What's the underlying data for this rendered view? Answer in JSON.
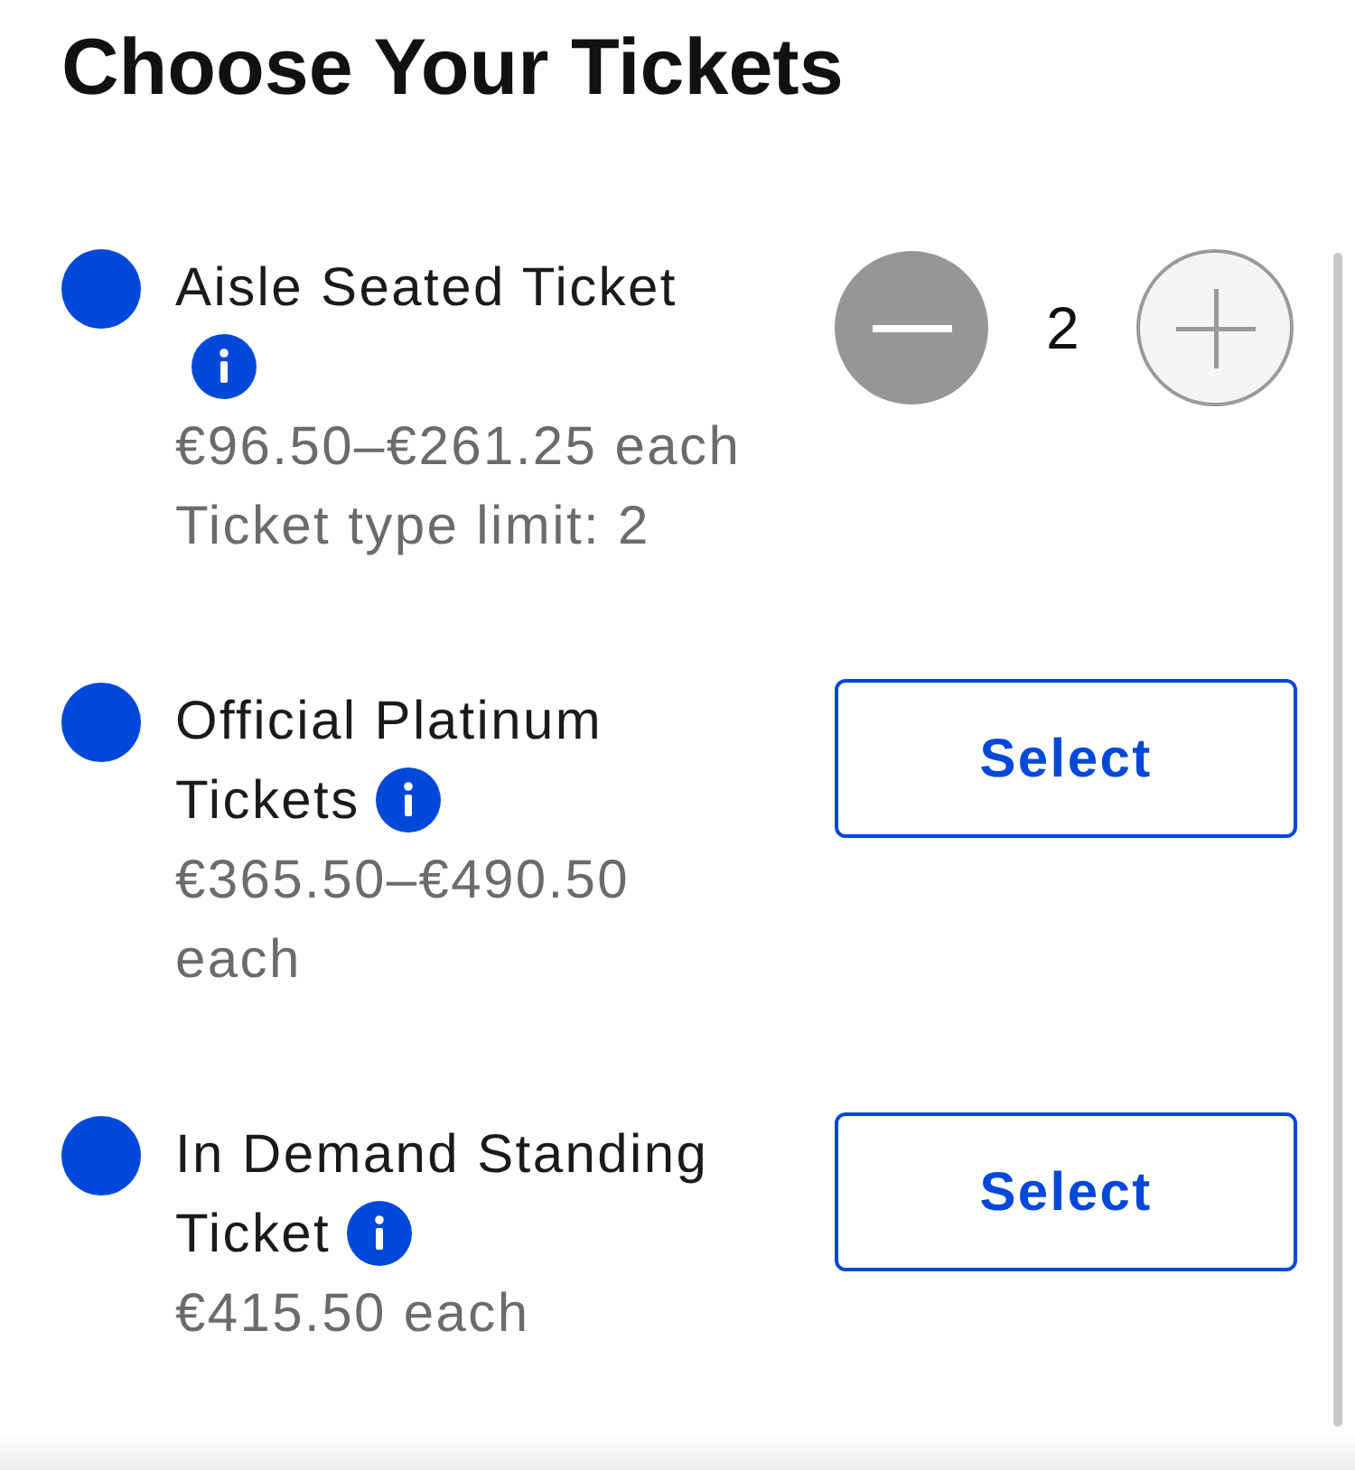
{
  "title": "Choose Your Tickets",
  "tickets": [
    {
      "name": "Aisle Seated Ticket",
      "price": "€96.50–€261.25 each",
      "limit": "Ticket type limit: 2",
      "control": {
        "kind": "stepper",
        "quantity": "2",
        "decrement_disabled": false,
        "increment_disabled": true
      }
    },
    {
      "name": "Official Platinum Tickets",
      "price": "€365.50–€490.50 each",
      "control": {
        "kind": "button",
        "label": "Select"
      }
    },
    {
      "name": "In Demand Standing Ticket",
      "price": "€415.50 each",
      "control": {
        "kind": "button",
        "label": "Select"
      }
    }
  ]
}
